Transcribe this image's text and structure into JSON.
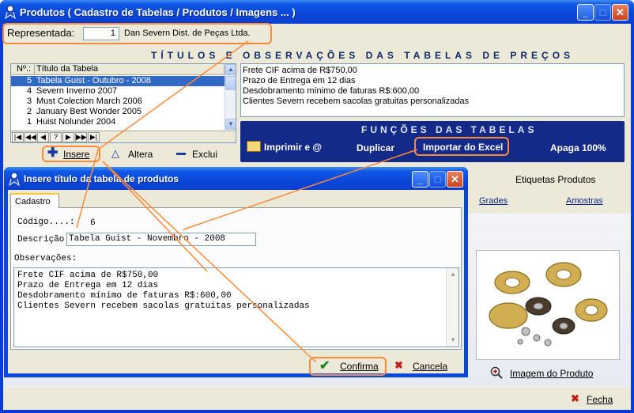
{
  "main_window": {
    "title": "Produtos ( Cadastro de Tabelas / Produtos / Imagens ... )"
  },
  "representada": {
    "label": "Representada:",
    "code": "1",
    "name": "Dan Severn Dist. de Peças Ltda."
  },
  "titulos_header": "TÍTULOS E OBSERVAÇÕES DAS TABELAS DE PREÇOS",
  "table": {
    "columns": [
      "Nº.:",
      "Título da Tabela"
    ],
    "rows": [
      {
        "num": "5",
        "title": "Tabela Guist - Outubro - 2008",
        "selected": true
      },
      {
        "num": "4",
        "title": "Severn Inverno 2007"
      },
      {
        "num": "3",
        "title": "Must Colection March 2006"
      },
      {
        "num": "2",
        "title": "January Best Wonder 2005"
      },
      {
        "num": "1",
        "title": "Huist Nolunder 2004"
      }
    ],
    "nav_buttons": [
      "|◀",
      "◀◀",
      "◀",
      "?",
      "▶",
      "▶▶",
      "▶|"
    ]
  },
  "table_actions": {
    "insert": "Insere",
    "edit": "Altera",
    "delete": "Exclui"
  },
  "observations": [
    "Frete CIF acima de R$750,00",
    "Prazo de Entrega em 12 dias",
    "Desdobramento mínimo de faturas R$:600,00",
    "Clientes Severn recebem sacolas gratuitas personalizadas"
  ],
  "functions_panel": {
    "header": "FUNÇÕES DAS TABELAS",
    "print": "Imprimir e @",
    "duplicate": "Duplicar",
    "import_excel": "Importar do Excel",
    "delete_all": "Apaga 100%"
  },
  "side_tabs": {
    "labels": "Etiquetas Produtos",
    "grades": "Grades",
    "samples": "Amostras"
  },
  "product_image_label": "Imagem do Produto",
  "close_label": "Fecha",
  "dialog": {
    "title": "Insere título da tabela de produtos",
    "tab": "Cadastro",
    "code_label": "Código....:",
    "code_value": "6",
    "desc_label": "Descrição:",
    "desc_value": "Tabela Guist - Novembro - 2008",
    "obs_label": "Observações:",
    "obs_lines": [
      "Frete CIF acima de R$750,00",
      "Prazo de Entrega em 12 dias",
      "Desdobramento mínimo de faturas R$:600,00",
      "Clientes Severn recebem sacolas gratuitas personalizadas"
    ],
    "confirm": "Confirma",
    "cancel": "Cancela"
  },
  "colors": {
    "xp_title_blue": "#0a47d8",
    "selection_blue": "#316ac5",
    "functions_panel": "#142a88",
    "highlight_orange": "#ff8a3a"
  }
}
